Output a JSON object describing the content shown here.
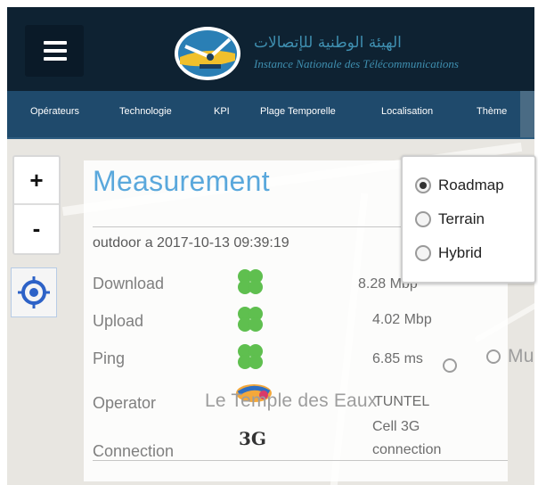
{
  "header": {
    "logo_arabic": "الهيئة الوطنية للإتصالات",
    "logo_french": "Instance Nationale des Télécommunications"
  },
  "nav": {
    "items": [
      {
        "label": "Opérateurs"
      },
      {
        "label": "Technologie"
      },
      {
        "label": "KPI"
      },
      {
        "label": "Plage Temporelle"
      },
      {
        "label": "Localisation"
      },
      {
        "label": "Thème"
      }
    ]
  },
  "map": {
    "zoom_in": "+",
    "zoom_out": "-",
    "place_label_1": "Le Temple des Eaux",
    "place_label_2": "Mu",
    "map_type": {
      "options": [
        {
          "label": "Roadmap",
          "selected": true
        },
        {
          "label": "Terrain",
          "selected": false
        },
        {
          "label": "Hybrid",
          "selected": false
        }
      ]
    }
  },
  "popup": {
    "title": "Measurement",
    "subtitle": "outdoor a 2017-10-13 09:39:19",
    "rows": {
      "download": {
        "label": "Download",
        "value": "8.28 Mbp"
      },
      "upload": {
        "label": "Upload",
        "value": "4.02 Mbp"
      },
      "ping": {
        "label": "Ping",
        "value": "6.85 ms"
      },
      "operator": {
        "label": "Operator",
        "value": "TUNTEL"
      },
      "connection": {
        "label": "Connection",
        "value_line1": "Cell 3G",
        "value_line2": "connection",
        "icon_text": "3G"
      }
    },
    "colors": {
      "title": "#5aa8dc",
      "clover": "#5fbf4f"
    }
  }
}
